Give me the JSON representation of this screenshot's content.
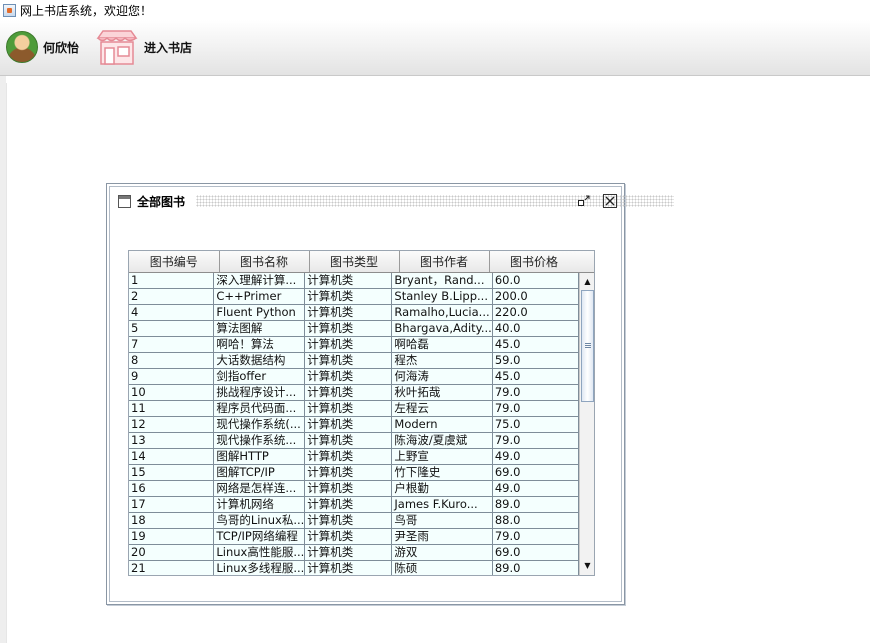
{
  "window": {
    "title": "网上书店系统，欢迎您！"
  },
  "toolbar": {
    "user_label": "何欣怡",
    "shop_label": "进入书店",
    "user_icon": "user-avatar-icon",
    "shop_icon": "storefront-icon"
  },
  "frame": {
    "title": "全部图书",
    "restore_glyph": "▫↙",
    "close_glyph": "☒"
  },
  "table": {
    "columns": [
      "图书编号",
      "图书名称",
      "图书类型",
      "图书作者",
      "图书价格"
    ],
    "rows": [
      [
        "1",
        "深入理解计算...",
        "计算机类",
        "Bryant，Rand...",
        "60.0"
      ],
      [
        "2",
        "C++Primer",
        "计算机类",
        "Stanley B.Lipp...",
        "200.0"
      ],
      [
        "4",
        "Fluent Python",
        "计算机类",
        "Ramalho,Lucia...",
        "220.0"
      ],
      [
        "5",
        "算法图解",
        "计算机类",
        "Bhargava,Adity...",
        "40.0"
      ],
      [
        "7",
        "啊哈！算法",
        "计算机类",
        "啊哈磊",
        "45.0"
      ],
      [
        "8",
        "大话数据结构",
        "计算机类",
        "程杰",
        "59.0"
      ],
      [
        "9",
        "剑指offer",
        "计算机类",
        "何海涛",
        "45.0"
      ],
      [
        "10",
        "挑战程序设计...",
        "计算机类",
        "秋叶拓哉",
        "79.0"
      ],
      [
        "11",
        "程序员代码面...",
        "计算机类",
        "左程云",
        "79.0"
      ],
      [
        "12",
        "现代操作系统(...",
        "计算机类",
        "Modern",
        "75.0"
      ],
      [
        "13",
        "现代操作系统...",
        "计算机类",
        "陈海波/夏虞斌",
        "79.0"
      ],
      [
        "14",
        "图解HTTP",
        "计算机类",
        "上野宣",
        "49.0"
      ],
      [
        "15",
        "图解TCP/IP",
        "计算机类",
        "竹下隆史",
        "69.0"
      ],
      [
        "16",
        "网络是怎样连...",
        "计算机类",
        "户根勤",
        "49.0"
      ],
      [
        "17",
        "计算机网络",
        "计算机类",
        "James F.Kuro...",
        "89.0"
      ],
      [
        "18",
        "鸟哥的Linux私...",
        "计算机类",
        "鸟哥",
        "88.0"
      ],
      [
        "19",
        "TCP/IP网络编程",
        "计算机类",
        "尹圣雨",
        "79.0"
      ],
      [
        "20",
        "Linux高性能服...",
        "计算机类",
        "游双",
        "69.0"
      ],
      [
        "21",
        "Linux多线程服...",
        "计算机类",
        "陈硕",
        "89.0"
      ]
    ],
    "scroll_position": 0
  },
  "colors": {
    "cell_bg": "#f4fffe",
    "grid_line": "#7e8d99"
  }
}
